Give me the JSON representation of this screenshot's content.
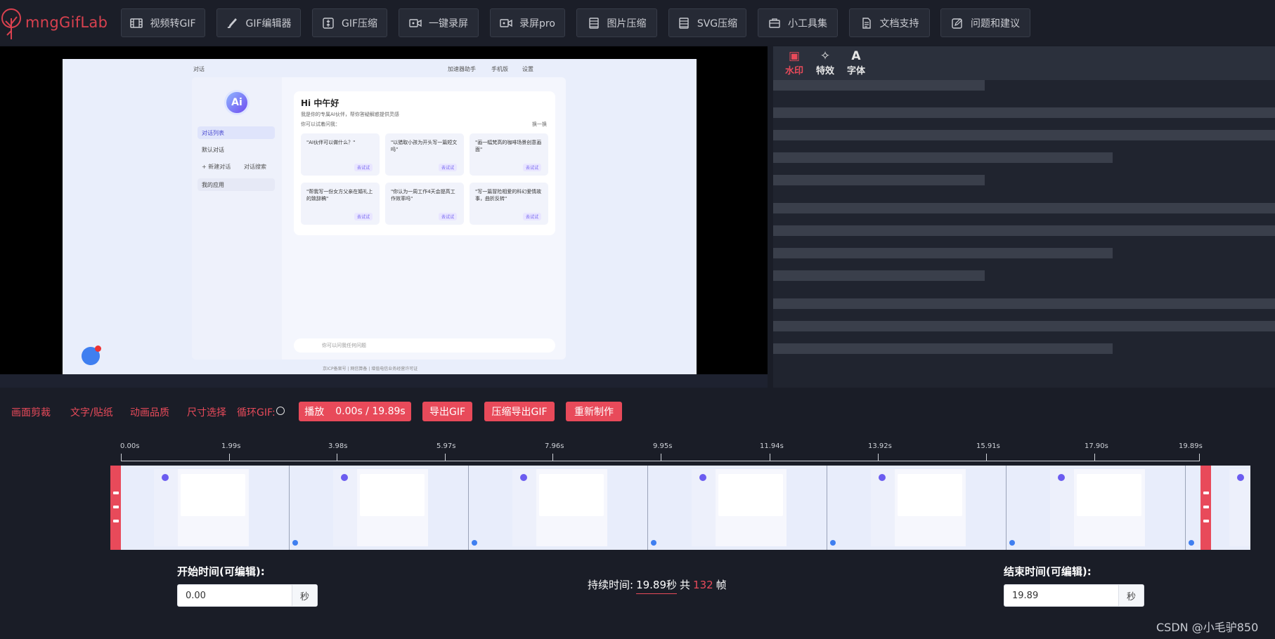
{
  "app": {
    "logo_text": "mngGifLab"
  },
  "nav": [
    {
      "label": "视频转GIF",
      "icon": "film-icon"
    },
    {
      "label": "GIF编辑器",
      "icon": "brush-icon"
    },
    {
      "label": "GIF压缩",
      "icon": "compress-icon"
    },
    {
      "label": "一键录屏",
      "icon": "camera-icon"
    },
    {
      "label": "录屏pro",
      "icon": "camera-icon"
    },
    {
      "label": "图片压缩",
      "icon": "image-compress-icon"
    },
    {
      "label": "SVG压缩",
      "icon": "svg-compress-icon"
    },
    {
      "label": "小工具集",
      "icon": "toolbox-icon"
    },
    {
      "label": "文档支持",
      "icon": "document-icon"
    },
    {
      "label": "问题和建议",
      "icon": "feedback-icon"
    }
  ],
  "preview": {
    "header_left": "对话",
    "header_right": [
      "加速器助手",
      "手机版",
      "设置"
    ],
    "sidebar": [
      "对话列表",
      "默认对话",
      "+ 新建对话",
      "对话搜索",
      "我的应用"
    ],
    "title": "Hi 中午好",
    "subtitle": "我是你的专属AI伙伴，帮你答疑解惑提供灵感",
    "hint": "你可以试着问我：",
    "refresh": "换一换",
    "suggestions": [
      "\"AI伙伴可以做什么？\"",
      "\"以猎取小孩为开头写一篇短文吗\"",
      "\"画一幅梵高的咖啡场景创意画面\"",
      "\"帮我写一份女方父亲在婚礼上的致辞稿\"",
      "\"你认为一周工作4天会提高工作效率吗\"",
      "\"写一篇冒险相爱的科幻爱情故事，曲折反转\""
    ],
    "try_label": "去试试",
    "input_placeholder": "你可以问我任何问题",
    "footer": "京ICP备案号 | 网信算备 | 增值电信业务经营许可证"
  },
  "right_panel": {
    "tabs": [
      {
        "label": "水印",
        "icon": "watermark-icon",
        "active": true
      },
      {
        "label": "特效",
        "icon": "pin-icon",
        "active": false
      },
      {
        "label": "字体",
        "icon": "font-icon",
        "active": false
      }
    ]
  },
  "controls": {
    "crop": "画面剪裁",
    "text_sticker": "文字/贴纸",
    "quality": "动画品质",
    "size": "尺寸选择",
    "loop": "循环GIF:",
    "play_label": "播放",
    "play_time": "0.00s / 19.89s",
    "export": "导出GIF",
    "compress_export": "压缩导出GIF",
    "remake": "重新制作"
  },
  "timeline": {
    "ticks": [
      "0.00s",
      "1.99s",
      "3.98s",
      "5.97s",
      "7.96s",
      "9.95s",
      "11.94s",
      "13.92s",
      "15.91s",
      "17.90s",
      "19.89s"
    ]
  },
  "fields": {
    "start_label": "开始时间(可编辑):",
    "start_value": "0.00",
    "end_label": "结束时间(可编辑):",
    "end_value": "19.89",
    "unit": "秒",
    "duration_label": "持续时间:",
    "duration_value": "19.89秒",
    "total_prefix": "共",
    "frame_count": "132",
    "frame_suffix": "帧"
  },
  "watermark": "CSDN @小毛驴850",
  "colors": {
    "accent": "#e84a5a",
    "background": "#1a1d27"
  }
}
